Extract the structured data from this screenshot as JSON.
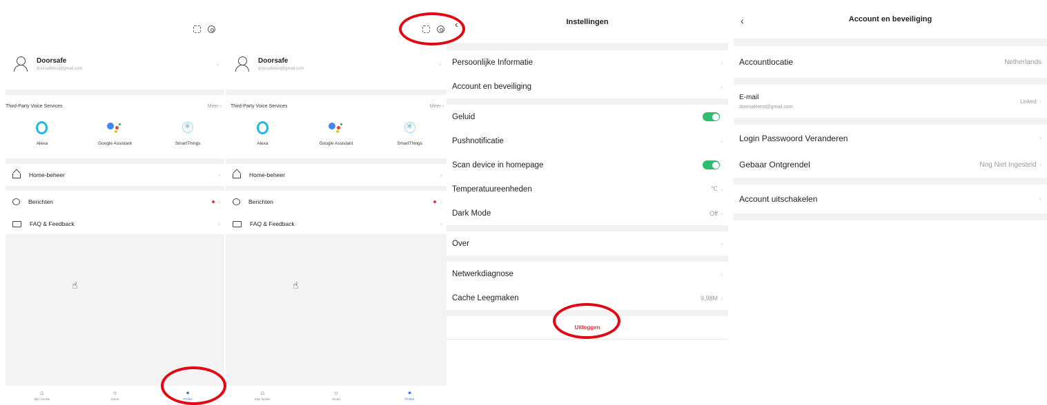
{
  "profile": {
    "user_name": "Doorsafe",
    "user_email": "doorsafetest@gmail.com",
    "voice_section_title": "Third-Party Voice Services",
    "voice_more": "Meer",
    "voice_services": [
      {
        "label": "Alexa",
        "icon": "alexa-icon"
      },
      {
        "label": "Google Assistant",
        "icon": "google-assistant-icon"
      },
      {
        "label": "SmartThings",
        "icon": "smartthings-icon"
      }
    ],
    "menu": {
      "home": "Home-beheer",
      "messages": "Berichten",
      "faq": "FAQ & Feedback"
    },
    "tabs": {
      "family": "Mijn familie",
      "smart": "Smart",
      "profile": "Profiel"
    },
    "accent_color": "#3b74f0",
    "badge_color": "#e53935"
  },
  "settings": {
    "title": "Instellingen",
    "items": {
      "personal": "Persoonlijke Informatie",
      "account": "Account en beveiliging",
      "sound": "Geluid",
      "push": "Pushnotificatie",
      "scan": "Scan device in homepage",
      "temperature": "Temperatuureenheden",
      "temperature_value": "℃",
      "dark_mode": "Dark Mode",
      "dark_mode_value": "Off",
      "about": "Over",
      "network": "Netwerkdiagnose",
      "cache": "Cache Leegmaken",
      "cache_value": "9,98M"
    },
    "logout": "Uitloggen",
    "toggle_color": "#2ebd6e",
    "logout_color": "#e8323a"
  },
  "account": {
    "title": "Account en beveiliging",
    "location_label": "Accountlocatie",
    "location_value": "Netherlands",
    "email_label": "E-mail",
    "email_value": "doorsafetest@gmail.com",
    "email_status": "Linked",
    "password_label": "Login Passwoord Veranderen",
    "gesture_label": "Gebaar Ontgrendel",
    "gesture_value": "Nog Niet Ingesteld",
    "disable_label": "Account uitschakelen"
  },
  "annotation_color": "#e30613"
}
